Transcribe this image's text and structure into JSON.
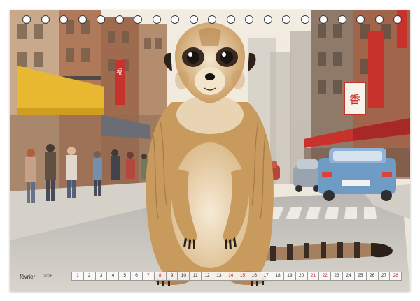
{
  "calendar": {
    "month": "février",
    "year": "2026",
    "days": [
      {
        "n": "1",
        "weekend": true
      },
      {
        "n": "2",
        "weekend": false
      },
      {
        "n": "3",
        "weekend": false
      },
      {
        "n": "4",
        "weekend": false
      },
      {
        "n": "5",
        "weekend": false
      },
      {
        "n": "6",
        "weekend": false
      },
      {
        "n": "7",
        "weekend": true
      },
      {
        "n": "8",
        "weekend": true
      },
      {
        "n": "9",
        "weekend": false
      },
      {
        "n": "10",
        "weekend": false
      },
      {
        "n": "11",
        "weekend": false
      },
      {
        "n": "12",
        "weekend": false
      },
      {
        "n": "13",
        "weekend": false
      },
      {
        "n": "14",
        "weekend": true
      },
      {
        "n": "15",
        "weekend": true
      },
      {
        "n": "16",
        "weekend": false
      },
      {
        "n": "17",
        "weekend": false
      },
      {
        "n": "18",
        "weekend": false
      },
      {
        "n": "19",
        "weekend": false
      },
      {
        "n": "20",
        "weekend": false
      },
      {
        "n": "21",
        "weekend": true
      },
      {
        "n": "22",
        "weekend": true
      },
      {
        "n": "23",
        "weekend": false
      },
      {
        "n": "24",
        "weekend": false
      },
      {
        "n": "25",
        "weekend": false
      },
      {
        "n": "26",
        "weekend": false
      },
      {
        "n": "27",
        "weekend": false
      },
      {
        "n": "28",
        "weekend": true
      }
    ]
  },
  "colors": {
    "sky": "#f4efe6",
    "meerkat_fur": "#c99a5e",
    "awning_yellow": "#e8b930",
    "sign_red": "#c8322c",
    "car_blue": "#6f9cc4",
    "weekend_red": "#c0262e"
  },
  "signs": {
    "left": "福",
    "right": "香"
  },
  "ring_count": 21
}
